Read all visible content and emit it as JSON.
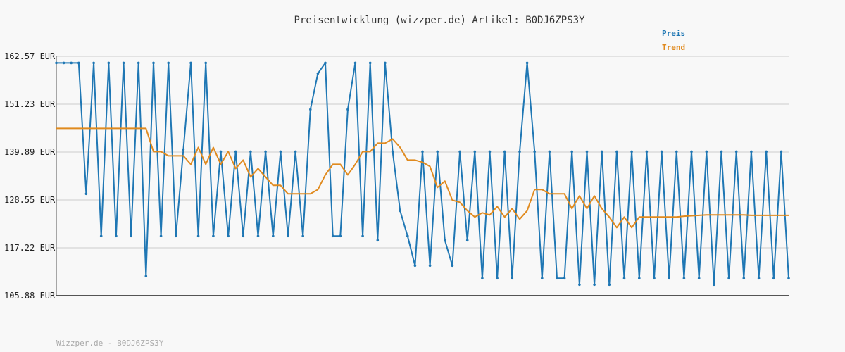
{
  "chart_data": {
    "type": "line",
    "title": "Preisentwicklung (wizzper.de) Artikel: B0DJ6ZPS3Y",
    "footer": "Wizzper.de - B0DJ6ZPS3Y",
    "y_ticks": [
      "162.57 EUR",
      "151.23 EUR",
      "139.89 EUR",
      "128.55 EUR",
      "117.22 EUR",
      "105.88 EUR"
    ],
    "y_tick_values": [
      162.57,
      151.23,
      139.89,
      128.55,
      117.22,
      105.88
    ],
    "ylim": [
      105.88,
      162.57
    ],
    "grid": true,
    "legend_position": "top-right",
    "colors": {
      "preis": "#1f77b4",
      "trend": "#e08a1e",
      "grid": "#e2e2e2",
      "axis": "#555555"
    },
    "series": [
      {
        "name": "Preis",
        "values": [
          161.0,
          161.0,
          161.0,
          161.0,
          130.0,
          161.0,
          120.0,
          161.0,
          120.0,
          161.0,
          120.0,
          161.0,
          110.5,
          161.0,
          120.0,
          161.0,
          120.0,
          140.5,
          161.0,
          120.0,
          161.0,
          120.0,
          140.0,
          120.0,
          140.0,
          120.0,
          140.0,
          120.0,
          140.0,
          120.0,
          140.0,
          120.0,
          140.0,
          120.0,
          150.0,
          158.5,
          161.0,
          120.0,
          120.0,
          150.0,
          161.0,
          120.0,
          161.0,
          119.0,
          161.0,
          140.0,
          126.0,
          120.0,
          113.0,
          140.0,
          113.0,
          140.0,
          119.0,
          113.0,
          140.0,
          119.0,
          140.0,
          110.0,
          140.0,
          110.0,
          140.0,
          110.0,
          140.0,
          161.0,
          140.0,
          110.0,
          140.0,
          110.0,
          110.0,
          140.0,
          108.5,
          140.0,
          108.5,
          140.0,
          108.5,
          140.0,
          110.0,
          140.0,
          110.0,
          140.0,
          110.0,
          140.0,
          110.0,
          140.0,
          110.0,
          140.0,
          110.0,
          140.0,
          108.5,
          140.0,
          110.0,
          140.0,
          110.0,
          140.0,
          110.0,
          140.0,
          110.0,
          140.0,
          110.0
        ]
      },
      {
        "name": "Trend",
        "values": [
          145.5,
          145.5,
          145.5,
          145.5,
          145.5,
          145.5,
          145.5,
          145.5,
          145.5,
          145.5,
          145.5,
          145.5,
          145.5,
          140.0,
          140.0,
          139.0,
          139.0,
          139.0,
          137.0,
          141.0,
          137.0,
          141.0,
          137.0,
          140.0,
          136.0,
          138.0,
          134.0,
          136.0,
          134.0,
          132.0,
          132.0,
          130.0,
          130.0,
          130.0,
          130.0,
          131.0,
          134.5,
          137.0,
          137.0,
          134.5,
          137.0,
          140.0,
          140.0,
          142.0,
          142.0,
          143.0,
          141.0,
          138.0,
          138.0,
          137.5,
          136.5,
          131.5,
          133.0,
          128.5,
          128.0,
          126.0,
          124.5,
          125.5,
          125.0,
          127.0,
          124.5,
          126.5,
          124.0,
          126.0,
          131.0,
          131.0,
          130.0,
          130.0,
          130.0,
          126.5,
          129.5,
          126.5,
          129.5,
          126.5,
          124.5,
          122.0,
          124.5,
          122.0,
          124.5,
          124.5,
          124.5,
          124.5,
          124.5,
          124.5,
          124.7,
          124.8,
          124.9,
          125.0,
          125.0,
          125.0,
          125.0,
          125.0,
          125.0,
          124.9,
          124.9,
          124.9,
          124.9,
          124.9,
          124.9
        ]
      }
    ]
  }
}
